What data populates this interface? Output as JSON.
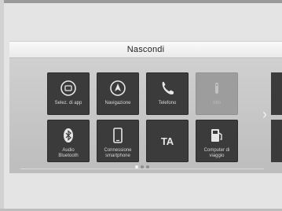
{
  "hide_bar": {
    "label": "Nascondi"
  },
  "tiles": [
    {
      "label": "Selez. di app",
      "icon": "app-select-icon",
      "enabled": true
    },
    {
      "label": "Navigazione",
      "icon": "navigation-icon",
      "enabled": true
    },
    {
      "label": "Telefono",
      "icon": "phone-icon",
      "enabled": true
    },
    {
      "label": "Info",
      "icon": "info-icon",
      "enabled": false
    },
    {
      "label": "Audio\nBluetooth",
      "icon": "bluetooth-icon",
      "enabled": true
    },
    {
      "label": "Connessione\nsmartphone",
      "icon": "smartphone-icon",
      "enabled": true
    },
    {
      "label": "",
      "icon": "ta-icon",
      "enabled": true,
      "icon_text": "TA"
    },
    {
      "label": "Computer di\nviaggio",
      "icon": "trip-computer-icon",
      "enabled": true
    }
  ],
  "pagination": {
    "pages": 3,
    "current": 1
  },
  "colors": {
    "tile": "#3b3b3b",
    "tile_disabled": "#9d9d9d",
    "panel": "#c6c6c6"
  }
}
